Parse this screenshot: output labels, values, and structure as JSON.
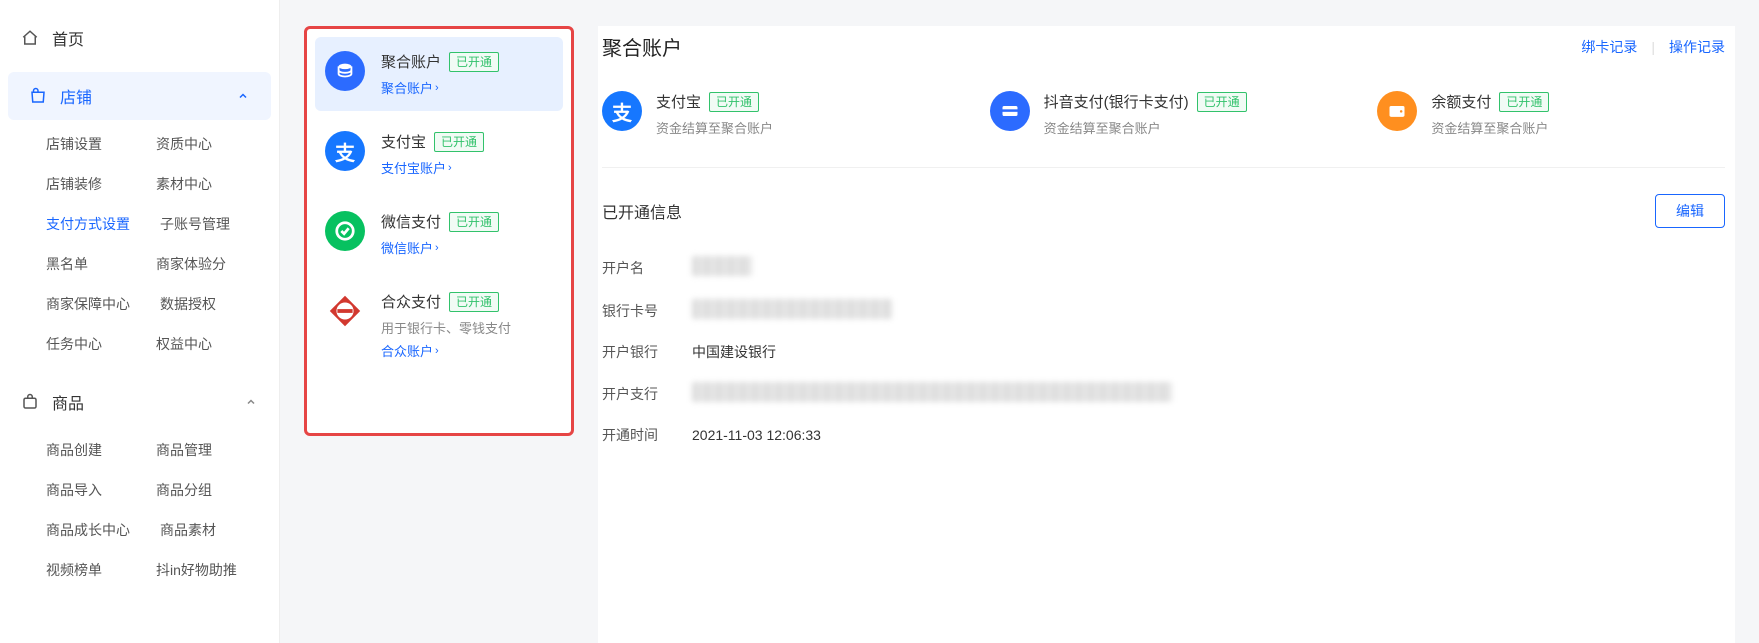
{
  "sidebar": {
    "home": "首页",
    "store": {
      "label": "店铺",
      "children": [
        [
          "店铺设置",
          "资质中心"
        ],
        [
          "店铺装修",
          "素材中心"
        ],
        [
          "支付方式设置",
          "子账号管理"
        ],
        [
          "黑名单",
          "商家体验分"
        ],
        [
          "商家保障中心",
          "数据授权"
        ],
        [
          "任务中心",
          "权益中心"
        ]
      ],
      "active_child": "支付方式设置"
    },
    "goods": {
      "label": "商品",
      "children": [
        [
          "商品创建",
          "商品管理"
        ],
        [
          "商品导入",
          "商品分组"
        ],
        [
          "商品成长中心",
          "商品素材"
        ],
        [
          "视频榜单",
          "抖in好物助推"
        ]
      ]
    }
  },
  "methods": {
    "status": "已开通",
    "items": [
      {
        "title": "聚合账户",
        "link": "聚合账户",
        "sub": ""
      },
      {
        "title": "支付宝",
        "link": "支付宝账户",
        "sub": ""
      },
      {
        "title": "微信支付",
        "link": "微信账户",
        "sub": ""
      },
      {
        "title": "合众支付",
        "link": "合众账户",
        "sub": "用于银行卡、零钱支付"
      }
    ]
  },
  "detail": {
    "title": "聚合账户",
    "actions": {
      "bind": "绑卡记录",
      "ops": "操作记录"
    },
    "channels": [
      {
        "title": "支付宝",
        "desc": "资金结算至聚合账户"
      },
      {
        "title": "抖音支付(银行卡支付)",
        "desc": "资金结算至聚合账户"
      },
      {
        "title": "余额支付",
        "desc": "资金结算至聚合账户"
      }
    ],
    "info_title": "已开通信息",
    "edit": "编辑",
    "rows": {
      "name_label": "开户名",
      "card_label": "银行卡号",
      "bank_label": "开户银行",
      "bank_value": "中国建设银行",
      "branch_label": "开户支行",
      "time_label": "开通时间",
      "time_value": "2021-11-03 12:06:33"
    }
  }
}
